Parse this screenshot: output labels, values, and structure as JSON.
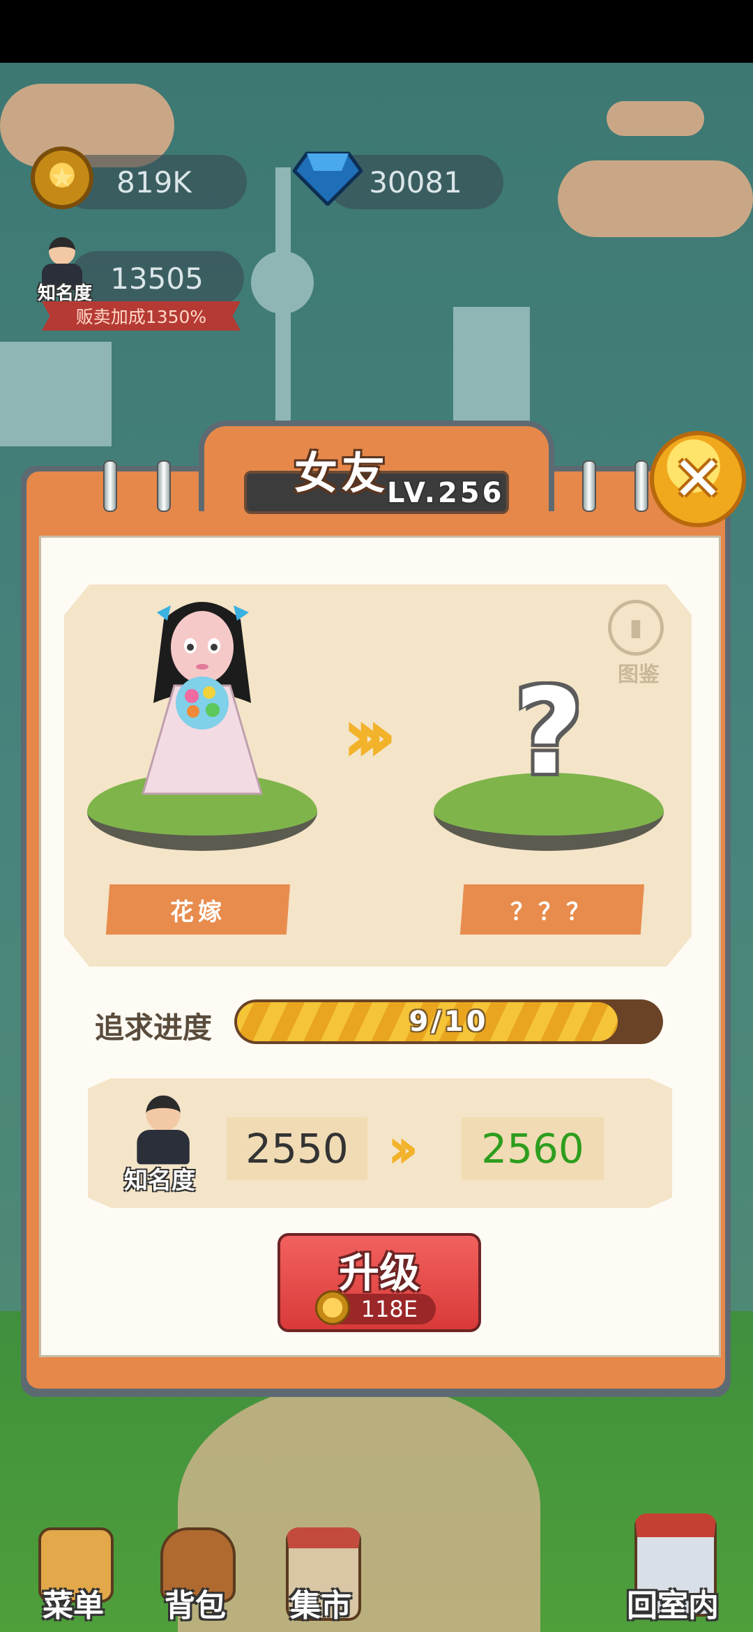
{
  "resources": {
    "gold": "819K",
    "gems": "30081",
    "fame_value": "13505",
    "fame_label": "知名度",
    "sell_bonus": "贩卖加成1350%"
  },
  "dialog": {
    "title": "女友",
    "level": "LV.256",
    "close_icon": "close-icon",
    "guide_label": "图鉴",
    "current_name": "花嫁",
    "next_name": "？？？",
    "progress_label": "追求进度",
    "progress_text": "9/10",
    "progress_fraction": 0.9,
    "fame_label": "知名度",
    "fame_current": "2550",
    "fame_next": "2560",
    "upgrade_label": "升级",
    "upgrade_cost": "118E"
  },
  "nav": {
    "menu": "菜单",
    "bag": "背包",
    "market": "集市",
    "home": "回室内"
  },
  "colors": {
    "accent_orange": "#e6884a",
    "upgrade_red": "#d93a39",
    "fame_next_green": "#2e9d1e"
  }
}
